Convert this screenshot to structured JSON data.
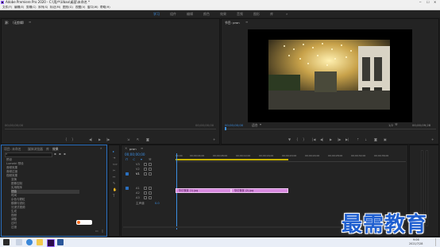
{
  "window": {
    "title": "Adobe Premiere Pro 2020 - C:\\用户\\Ubao\\桌面\\未命名 *"
  },
  "menu": {
    "items": [
      "文件(F)",
      "编辑(E)",
      "剪辑(C)",
      "序列(S)",
      "标记(M)",
      "图形(G)",
      "视图(V)",
      "窗口(W)",
      "帮助(H)"
    ]
  },
  "workspaces": {
    "items": [
      "学习",
      "组件",
      "编辑",
      "颜色",
      "效果",
      "音频",
      "图形",
      "库"
    ],
    "active": "学习",
    "more": "»"
  },
  "source_panel": {
    "tab": "源：（无剪辑）",
    "timecode_left": "00;00;00;00",
    "timecode_right": "00;00;00;00"
  },
  "program_panel": {
    "tab": "节目: pron",
    "timecode": "00;00;00;00",
    "fit": "适合",
    "ratio": "1/2",
    "duration": "00;00;09;28"
  },
  "project_panel": {
    "tabs": [
      "项目: 未命名",
      "媒体浏览器",
      "库",
      "效果"
    ],
    "active_tab": "效果",
    "items": [
      "预设",
      "Lumetri 预设",
      "音频效果",
      "音频过渡",
      "视频效果",
      "变换",
      "图像控制",
      "实用程序",
      "扭曲",
      "时间",
      "杂色与颗粒",
      "模糊与锐化",
      "沉浸式视频",
      "生成",
      "视频",
      "调整",
      "过时",
      "过渡"
    ]
  },
  "timeline": {
    "sequence_tab": "pron",
    "timecode": "00;00;00;00",
    "ruler_labels": [
      "00;00",
      "00;00;04;00",
      "00;00;08;00",
      "00;00;12;00",
      "00;00;16;00",
      "00;00;20;00",
      "00;00;24;00",
      "00;00;28;00",
      "00;00;32;00",
      "00;00;36;00"
    ],
    "video_tracks": [
      "V3",
      "V2",
      "V1"
    ],
    "audio_tracks": [
      "A1",
      "A2",
      "A3"
    ],
    "master": "主声道",
    "master_value": "0.0",
    "clips": [
      "华灯夜景 (1).jpg",
      "华灯夜景 (2).jpg"
    ]
  },
  "taskbar": {
    "time": "9:06",
    "date": "2021/7/28"
  },
  "watermark": {
    "text": "最需教育"
  },
  "colors": {
    "accent": "#3c8fe3",
    "clip": "#d88ae0",
    "panel": "#232323",
    "background": "#1d1d1d"
  }
}
